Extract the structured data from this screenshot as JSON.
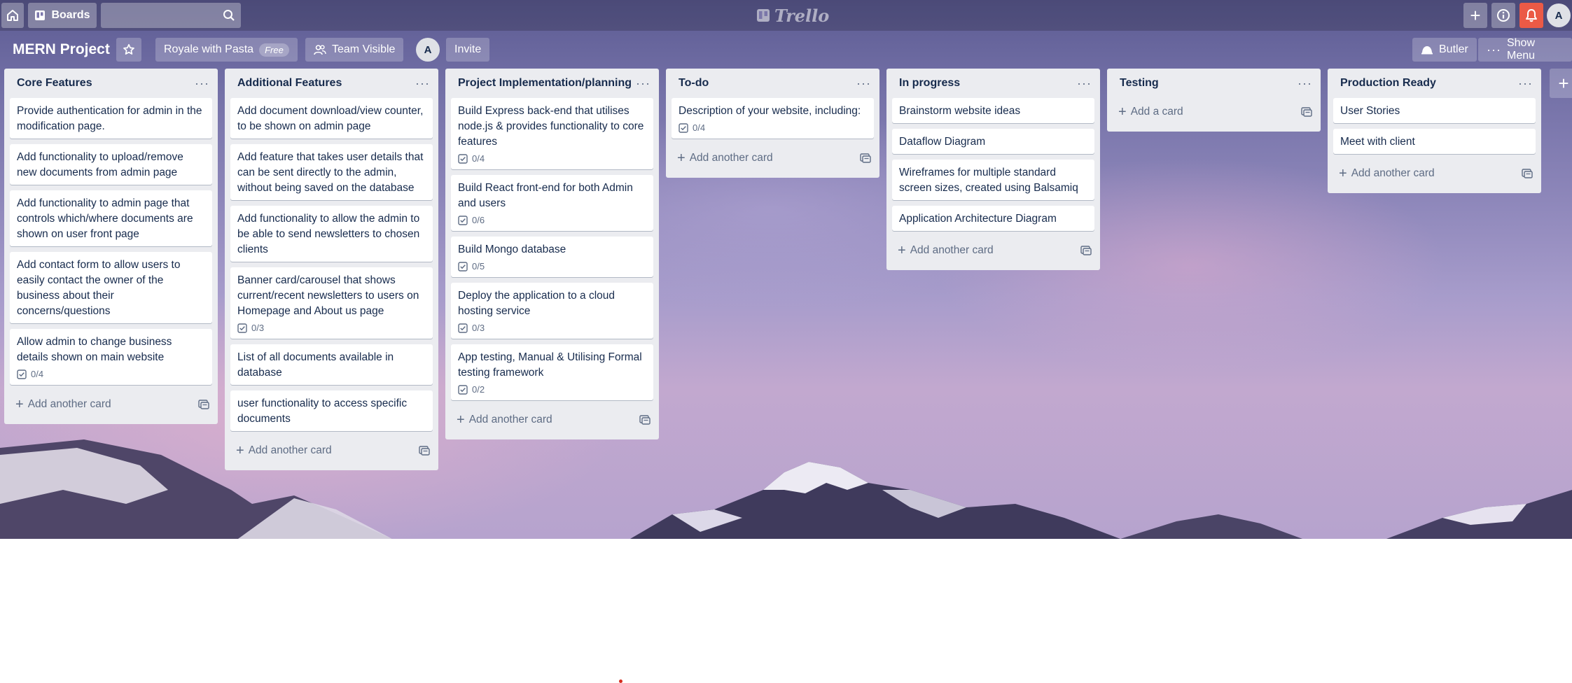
{
  "header": {
    "home_icon": "home-icon",
    "boards_label": "Boards",
    "search_placeholder": "",
    "logo_text": "Trello",
    "user_initial": "A"
  },
  "board": {
    "title": "MERN Project",
    "team_name": "Royale with Pasta",
    "team_badge": "Free",
    "visibility": "Team Visible",
    "member_initial": "A",
    "invite_label": "Invite",
    "butler_label": "Butler",
    "show_menu_label": "Show Menu"
  },
  "lists": [
    {
      "title": "Core Features",
      "add_label": "Add another card",
      "cards": [
        {
          "text": "Provide authentication for admin in the modification page."
        },
        {
          "text": "Add functionality to upload/remove new documents from admin page"
        },
        {
          "text": "Add functionality to admin page that controls which/where documents are shown on user front page"
        },
        {
          "text": "Add contact form to allow users to easily contact the owner of the business about their concerns/questions"
        },
        {
          "text": "Allow admin to change business details shown on main website",
          "checklist": "0/4"
        }
      ]
    },
    {
      "title": "Additional Features",
      "add_label": "Add another card",
      "cards": [
        {
          "text": "Add document download/view counter, to be shown on admin page"
        },
        {
          "text": "Add feature that takes user details that can be sent directly to the admin, without being saved on the database"
        },
        {
          "text": "Add functionality to allow the admin to be able to send newsletters to chosen clients"
        },
        {
          "text": "Banner card/carousel that shows current/recent newsletters to users on Homepage and About us page",
          "checklist": "0/3"
        },
        {
          "text": "List of all documents available in database"
        },
        {
          "text": "user functionality to access specific documents"
        }
      ]
    },
    {
      "title": "Project Implementation/planning",
      "add_label": "Add another card",
      "cards": [
        {
          "text": "Build Express back-end that utilises node.js & provides functionality to core features",
          "checklist": "0/4"
        },
        {
          "text": "Build React front-end for both Admin and users",
          "checklist": "0/6"
        },
        {
          "text": "Build Mongo database",
          "checklist": "0/5"
        },
        {
          "text": "Deploy the application to a cloud hosting service",
          "checklist": "0/3"
        },
        {
          "text": "App testing, Manual & Utilising Formal testing framework",
          "checklist": "0/2"
        }
      ]
    },
    {
      "title": "To-do",
      "add_label": "Add another card",
      "cards": [
        {
          "text": "Description of your website, including:",
          "checklist": "0/4"
        }
      ]
    },
    {
      "title": "In progress",
      "add_label": "Add another card",
      "cards": [
        {
          "text": "Brainstorm website ideas"
        },
        {
          "text": "Dataflow Diagram"
        },
        {
          "text": "Wireframes for multiple standard screen sizes, created using Balsamiq"
        },
        {
          "text": "Application Architecture Diagram"
        }
      ]
    },
    {
      "title": "Testing",
      "add_label": "Add a card",
      "cards": []
    },
    {
      "title": "Production Ready",
      "add_label": "Add another card",
      "cards": [
        {
          "text": "User Stories"
        },
        {
          "text": "Meet with client"
        }
      ]
    }
  ],
  "colors": {
    "list_bg": "#ebecf0",
    "card_bg": "#ffffff",
    "text": "#172b4d",
    "muted": "#5e6c84",
    "notification": "#eb5a46"
  }
}
